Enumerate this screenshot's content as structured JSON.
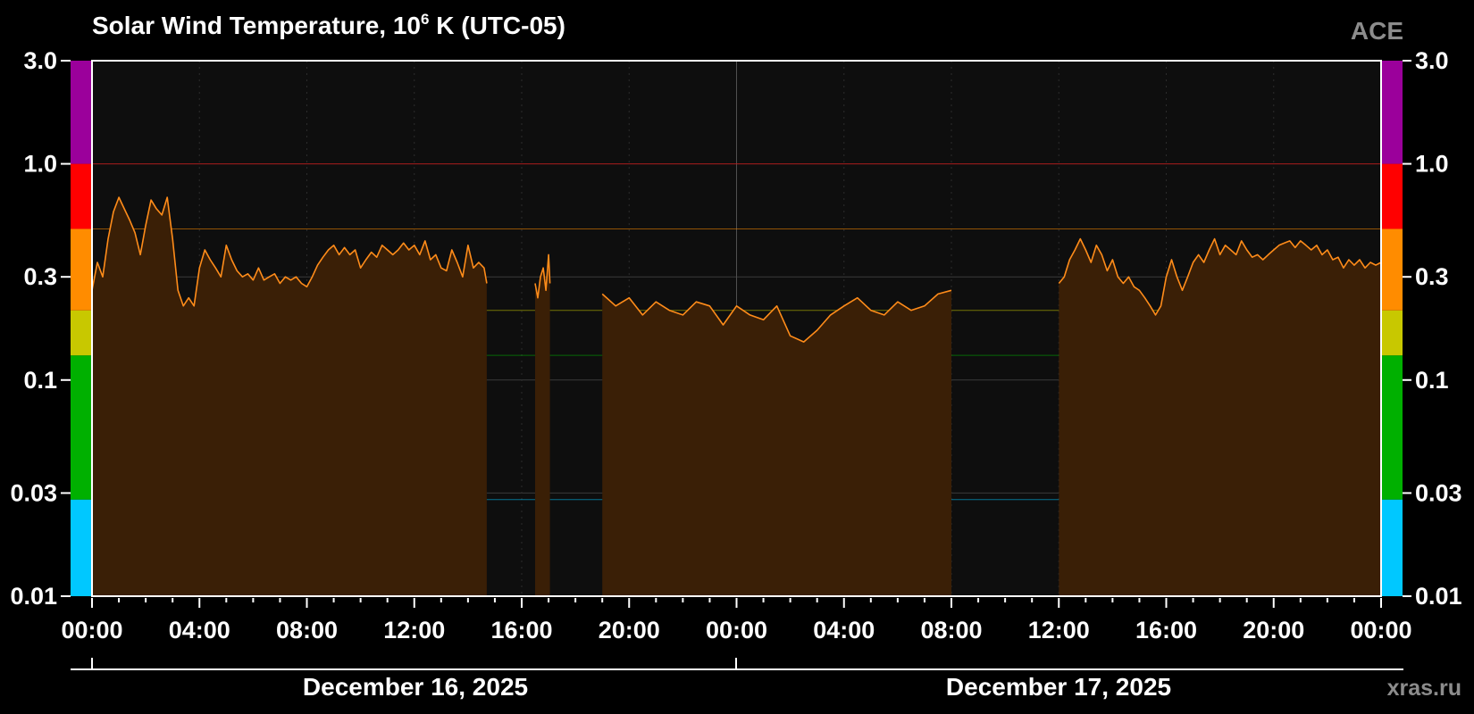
{
  "chart_data": {
    "type": "area",
    "title_main": "Solar Wind Temperature, 10",
    "title_exp": "6",
    "title_rest": " K (UTC-05)",
    "source_label": "ACE",
    "watermark": "xras.ru",
    "y_scale": "log",
    "ylim": [
      0.01,
      3.0
    ],
    "y_ticks": [
      "3.0",
      "1.0",
      "0.3",
      "0.1",
      "0.03",
      "0.01"
    ],
    "y_tick_values": [
      3.0,
      1.0,
      0.3,
      0.1,
      0.03,
      0.01
    ],
    "x_unit": "hours since 00:00 December 16, 2025 (UTC-05)",
    "xlim": [
      0,
      48
    ],
    "x_ticks": [
      "00:00",
      "04:00",
      "08:00",
      "12:00",
      "16:00",
      "20:00",
      "00:00",
      "04:00",
      "08:00",
      "12:00",
      "16:00",
      "20:00",
      "00:00"
    ],
    "x_tick_values": [
      0,
      4,
      8,
      12,
      16,
      20,
      24,
      28,
      32,
      36,
      40,
      44,
      48
    ],
    "date_labels": [
      "December 16, 2025",
      "December 17, 2025"
    ],
    "grid": true,
    "threshold_bands": [
      {
        "from": 0.01,
        "to": 0.028,
        "color": "#00c8ff"
      },
      {
        "from": 0.028,
        "to": 0.13,
        "color": "#00b000"
      },
      {
        "from": 0.13,
        "to": 0.21,
        "color": "#c8c800"
      },
      {
        "from": 0.21,
        "to": 0.5,
        "color": "#ff8c00"
      },
      {
        "from": 0.5,
        "to": 1.0,
        "color": "#ff0000"
      },
      {
        "from": 1.0,
        "to": 3.0,
        "color": "#9b009b"
      }
    ],
    "series": [
      {
        "color": "#ff8c1a",
        "fill": "#3a1f06",
        "segments": [
          [
            [
              0.0,
              0.26
            ],
            [
              0.2,
              0.35
            ],
            [
              0.4,
              0.3
            ],
            [
              0.6,
              0.45
            ],
            [
              0.8,
              0.6
            ],
            [
              1.0,
              0.7
            ],
            [
              1.2,
              0.62
            ],
            [
              1.4,
              0.55
            ],
            [
              1.6,
              0.48
            ],
            [
              1.8,
              0.38
            ],
            [
              2.0,
              0.52
            ],
            [
              2.2,
              0.68
            ],
            [
              2.4,
              0.62
            ],
            [
              2.6,
              0.58
            ],
            [
              2.8,
              0.7
            ],
            [
              3.0,
              0.45
            ],
            [
              3.2,
              0.26
            ],
            [
              3.4,
              0.22
            ],
            [
              3.6,
              0.24
            ],
            [
              3.8,
              0.22
            ],
            [
              4.0,
              0.33
            ],
            [
              4.2,
              0.4
            ],
            [
              4.4,
              0.36
            ],
            [
              4.6,
              0.33
            ],
            [
              4.8,
              0.3
            ],
            [
              5.0,
              0.42
            ],
            [
              5.2,
              0.36
            ],
            [
              5.4,
              0.32
            ],
            [
              5.6,
              0.3
            ],
            [
              5.8,
              0.31
            ],
            [
              6.0,
              0.29
            ],
            [
              6.2,
              0.33
            ],
            [
              6.4,
              0.29
            ],
            [
              6.6,
              0.3
            ],
            [
              6.8,
              0.31
            ],
            [
              7.0,
              0.28
            ],
            [
              7.2,
              0.3
            ],
            [
              7.4,
              0.29
            ],
            [
              7.6,
              0.3
            ],
            [
              7.8,
              0.28
            ],
            [
              8.0,
              0.27
            ],
            [
              8.2,
              0.3
            ],
            [
              8.4,
              0.34
            ],
            [
              8.6,
              0.37
            ],
            [
              8.8,
              0.4
            ],
            [
              9.0,
              0.42
            ],
            [
              9.2,
              0.38
            ],
            [
              9.4,
              0.41
            ],
            [
              9.6,
              0.38
            ],
            [
              9.8,
              0.4
            ],
            [
              10.0,
              0.33
            ],
            [
              10.2,
              0.36
            ],
            [
              10.4,
              0.39
            ],
            [
              10.6,
              0.37
            ],
            [
              10.8,
              0.42
            ],
            [
              11.0,
              0.4
            ],
            [
              11.2,
              0.38
            ],
            [
              11.4,
              0.4
            ],
            [
              11.6,
              0.43
            ],
            [
              11.8,
              0.4
            ],
            [
              12.0,
              0.42
            ],
            [
              12.2,
              0.38
            ],
            [
              12.4,
              0.44
            ],
            [
              12.6,
              0.36
            ],
            [
              12.8,
              0.38
            ],
            [
              13.0,
              0.33
            ],
            [
              13.2,
              0.32
            ],
            [
              13.4,
              0.4
            ],
            [
              13.6,
              0.35
            ],
            [
              13.8,
              0.3
            ],
            [
              14.0,
              0.42
            ],
            [
              14.2,
              0.33
            ],
            [
              14.4,
              0.35
            ],
            [
              14.6,
              0.33
            ],
            [
              14.7,
              0.28
            ]
          ],
          [
            [
              16.5,
              0.28
            ],
            [
              16.6,
              0.24
            ],
            [
              16.7,
              0.3
            ],
            [
              16.8,
              0.33
            ],
            [
              16.9,
              0.26
            ],
            [
              17.0,
              0.38
            ],
            [
              17.05,
              0.28
            ]
          ],
          [
            [
              19.0,
              0.25
            ],
            [
              19.5,
              0.22
            ],
            [
              20.0,
              0.24
            ],
            [
              20.5,
              0.2
            ],
            [
              21.0,
              0.23
            ],
            [
              21.5,
              0.21
            ],
            [
              22.0,
              0.2
            ],
            [
              22.5,
              0.23
            ],
            [
              23.0,
              0.22
            ],
            [
              23.5,
              0.18
            ],
            [
              24.0,
              0.22
            ],
            [
              24.5,
              0.2
            ],
            [
              25.0,
              0.19
            ],
            [
              25.5,
              0.22
            ],
            [
              26.0,
              0.16
            ],
            [
              26.5,
              0.15
            ],
            [
              27.0,
              0.17
            ],
            [
              27.5,
              0.2
            ],
            [
              28.0,
              0.22
            ],
            [
              28.5,
              0.24
            ],
            [
              29.0,
              0.21
            ],
            [
              29.5,
              0.2
            ],
            [
              30.0,
              0.23
            ],
            [
              30.5,
              0.21
            ],
            [
              31.0,
              0.22
            ],
            [
              31.5,
              0.25
            ],
            [
              32.0,
              0.26
            ]
          ],
          [
            [
              36.0,
              0.28
            ],
            [
              36.2,
              0.3
            ],
            [
              36.4,
              0.36
            ],
            [
              36.6,
              0.4
            ],
            [
              36.8,
              0.45
            ],
            [
              37.0,
              0.4
            ],
            [
              37.2,
              0.35
            ],
            [
              37.4,
              0.42
            ],
            [
              37.6,
              0.38
            ],
            [
              37.8,
              0.32
            ],
            [
              38.0,
              0.36
            ],
            [
              38.2,
              0.3
            ],
            [
              38.4,
              0.28
            ],
            [
              38.6,
              0.3
            ],
            [
              38.8,
              0.27
            ],
            [
              39.0,
              0.26
            ],
            [
              39.2,
              0.24
            ],
            [
              39.4,
              0.22
            ],
            [
              39.6,
              0.2
            ],
            [
              39.8,
              0.22
            ],
            [
              40.0,
              0.3
            ],
            [
              40.2,
              0.36
            ],
            [
              40.4,
              0.3
            ],
            [
              40.6,
              0.26
            ],
            [
              40.8,
              0.3
            ],
            [
              41.0,
              0.35
            ],
            [
              41.2,
              0.38
            ],
            [
              41.4,
              0.35
            ],
            [
              41.6,
              0.4
            ],
            [
              41.8,
              0.45
            ],
            [
              42.0,
              0.38
            ],
            [
              42.2,
              0.42
            ],
            [
              42.4,
              0.4
            ],
            [
              42.6,
              0.38
            ],
            [
              42.8,
              0.44
            ],
            [
              43.0,
              0.4
            ],
            [
              43.2,
              0.37
            ],
            [
              43.4,
              0.38
            ],
            [
              43.6,
              0.36
            ],
            [
              43.8,
              0.38
            ],
            [
              44.0,
              0.4
            ],
            [
              44.2,
              0.42
            ],
            [
              44.4,
              0.43
            ],
            [
              44.6,
              0.44
            ],
            [
              44.8,
              0.41
            ],
            [
              45.0,
              0.44
            ],
            [
              45.2,
              0.42
            ],
            [
              45.4,
              0.4
            ],
            [
              45.6,
              0.42
            ],
            [
              45.8,
              0.38
            ],
            [
              46.0,
              0.4
            ],
            [
              46.2,
              0.36
            ],
            [
              46.4,
              0.37
            ],
            [
              46.6,
              0.33
            ],
            [
              46.8,
              0.36
            ],
            [
              47.0,
              0.34
            ],
            [
              47.2,
              0.36
            ],
            [
              47.4,
              0.33
            ],
            [
              47.6,
              0.35
            ],
            [
              47.8,
              0.34
            ],
            [
              48.0,
              0.35
            ]
          ]
        ]
      }
    ]
  }
}
